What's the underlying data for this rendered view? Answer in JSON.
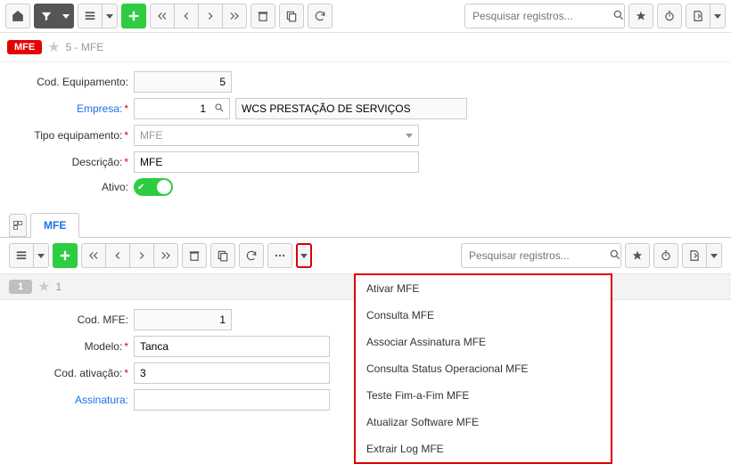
{
  "top_search": {
    "placeholder": "Pesquisar registros..."
  },
  "header": {
    "badge": "MFE",
    "title": "5 - MFE"
  },
  "form": {
    "cod_equipamento": {
      "label": "Cod. Equipamento:",
      "value": "5"
    },
    "empresa": {
      "label": "Empresa:",
      "value": "1",
      "display": "WCS PRESTAÇÃO DE SERVIÇOS"
    },
    "tipo_equipamento": {
      "label": "Tipo equipamento:",
      "value": "MFE"
    },
    "descricao": {
      "label": "Descrição:",
      "value": "MFE"
    },
    "ativo": {
      "label": "Ativo:"
    }
  },
  "tab": {
    "label": "MFE"
  },
  "sub_search": {
    "placeholder": "Pesquisar registros..."
  },
  "sub_header": {
    "badge": "1",
    "title": "1"
  },
  "sub_form": {
    "cod_mfe": {
      "label": "Cod. MFE:",
      "value": "1"
    },
    "modelo": {
      "label": "Modelo:",
      "value": "Tanca"
    },
    "cod_ativacao": {
      "label": "Cod. ativação:",
      "value": "3"
    },
    "assinatura": {
      "label": "Assinatura:",
      "value": ""
    }
  },
  "dropdown": {
    "items": [
      "Ativar MFE",
      "Consulta MFE",
      "Associar Assinatura MFE",
      "Consulta Status Operacional MFE",
      "Teste Fim-a-Fim MFE",
      "Atualizar Software MFE",
      "Extrair Log MFE"
    ]
  }
}
